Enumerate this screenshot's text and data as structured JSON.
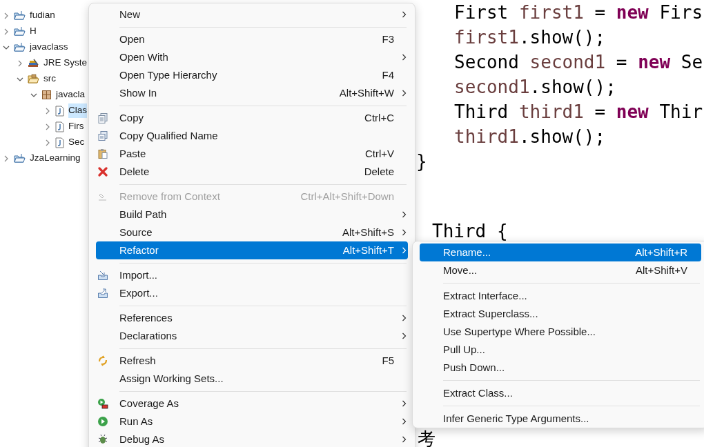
{
  "project_tree": [
    {
      "label": "fudian",
      "kind": "project",
      "expanded": false,
      "selected": false
    },
    {
      "label": "H",
      "kind": "project",
      "expanded": false,
      "selected": false
    },
    {
      "label": "javaclass",
      "kind": "project",
      "expanded": true,
      "selected": false,
      "children": [
        {
          "label": "JRE Syste",
          "kind": "library",
          "expanded": false,
          "selected": false
        },
        {
          "label": "src",
          "kind": "source-folder",
          "expanded": true,
          "selected": false,
          "children": [
            {
              "label": "javacla",
              "kind": "package",
              "expanded": true,
              "selected": false,
              "children": [
                {
                  "label": "Clas",
                  "kind": "java-file",
                  "expanded": false,
                  "selected": true
                },
                {
                  "label": "Firs",
                  "kind": "java-file",
                  "expanded": false,
                  "selected": false
                },
                {
                  "label": "Sec",
                  "kind": "java-file",
                  "expanded": false,
                  "selected": false
                }
              ]
            }
          ]
        }
      ]
    },
    {
      "label": "JzaLearning",
      "kind": "project",
      "expanded": false,
      "selected": false
    }
  ],
  "code_lines": [
    {
      "tokens": [
        {
          "text": "First ",
          "kind": "plain"
        },
        {
          "text": "first1",
          "kind": "variable"
        },
        {
          "text": " = ",
          "kind": "plain"
        },
        {
          "text": "new",
          "kind": "keyword"
        },
        {
          "text": " Firs",
          "kind": "plain"
        }
      ]
    },
    {
      "tokens": [
        {
          "text": "first1",
          "kind": "variable"
        },
        {
          "text": ".show();",
          "kind": "plain"
        }
      ]
    },
    {
      "tokens": [
        {
          "text": "Second ",
          "kind": "plain"
        },
        {
          "text": "second1",
          "kind": "variable"
        },
        {
          "text": " = ",
          "kind": "plain"
        },
        {
          "text": "new",
          "kind": "keyword"
        },
        {
          "text": " Se",
          "kind": "plain"
        }
      ]
    },
    {
      "tokens": [
        {
          "text": "second1",
          "kind": "variable"
        },
        {
          "text": ".show();",
          "kind": "plain"
        }
      ]
    },
    {
      "tokens": [
        {
          "text": "Third ",
          "kind": "plain"
        },
        {
          "text": "third1",
          "kind": "variable"
        },
        {
          "text": " = ",
          "kind": "plain"
        },
        {
          "text": "new",
          "kind": "keyword"
        },
        {
          "text": " Thir",
          "kind": "plain"
        }
      ]
    },
    {
      "tokens": [
        {
          "text": "third1",
          "kind": "variable"
        },
        {
          "text": ".show();",
          "kind": "plain"
        }
      ]
    },
    {
      "tokens": [
        {
          "text": "}",
          "kind": "plain"
        }
      ]
    },
    {
      "tokens": [
        {
          "text": "Third {",
          "kind": "plain"
        }
      ]
    },
    {
      "tokens": [
        {
          "text": "考",
          "kind": "plain"
        }
      ]
    }
  ],
  "context_menu": [
    {
      "kind": "item",
      "label": "New",
      "has_submenu": true,
      "disabled": false,
      "selected": false
    },
    {
      "kind": "separator"
    },
    {
      "kind": "item",
      "label": "Open",
      "shortcut": "F3",
      "has_submenu": false,
      "disabled": false,
      "selected": false
    },
    {
      "kind": "item",
      "label": "Open With",
      "has_submenu": true,
      "disabled": false,
      "selected": false
    },
    {
      "kind": "item",
      "label": "Open Type Hierarchy",
      "shortcut": "F4",
      "has_submenu": false,
      "disabled": false,
      "selected": false
    },
    {
      "kind": "item",
      "label": "Show In",
      "shortcut": "Alt+Shift+W",
      "has_submenu": true,
      "disabled": false,
      "selected": false
    },
    {
      "kind": "separator"
    },
    {
      "kind": "item",
      "label": "Copy",
      "shortcut": "Ctrl+C",
      "has_submenu": false,
      "disabled": false,
      "selected": false
    },
    {
      "kind": "item",
      "label": "Copy Qualified Name",
      "has_submenu": false,
      "disabled": false,
      "selected": false
    },
    {
      "kind": "item",
      "label": "Paste",
      "shortcut": "Ctrl+V",
      "has_submenu": false,
      "disabled": false,
      "selected": false
    },
    {
      "kind": "item",
      "label": "Delete",
      "shortcut": "Delete",
      "has_submenu": false,
      "disabled": false,
      "selected": false
    },
    {
      "kind": "separator"
    },
    {
      "kind": "item",
      "label": "Remove from Context",
      "shortcut": "Ctrl+Alt+Shift+Down",
      "has_submenu": false,
      "disabled": true,
      "selected": false
    },
    {
      "kind": "item",
      "label": "Build Path",
      "has_submenu": true,
      "disabled": false,
      "selected": false
    },
    {
      "kind": "item",
      "label": "Source",
      "shortcut": "Alt+Shift+S",
      "has_submenu": true,
      "disabled": false,
      "selected": false
    },
    {
      "kind": "item",
      "label": "Refactor",
      "shortcut": "Alt+Shift+T",
      "has_submenu": true,
      "disabled": false,
      "selected": true
    },
    {
      "kind": "separator"
    },
    {
      "kind": "item",
      "label": "Import...",
      "has_submenu": false,
      "disabled": false,
      "selected": false
    },
    {
      "kind": "item",
      "label": "Export...",
      "has_submenu": false,
      "disabled": false,
      "selected": false
    },
    {
      "kind": "separator"
    },
    {
      "kind": "item",
      "label": "References",
      "has_submenu": true,
      "disabled": false,
      "selected": false
    },
    {
      "kind": "item",
      "label": "Declarations",
      "has_submenu": true,
      "disabled": false,
      "selected": false
    },
    {
      "kind": "separator"
    },
    {
      "kind": "item",
      "label": "Refresh",
      "shortcut": "F5",
      "has_submenu": false,
      "disabled": false,
      "selected": false
    },
    {
      "kind": "item",
      "label": "Assign Working Sets...",
      "has_submenu": false,
      "disabled": false,
      "selected": false
    },
    {
      "kind": "separator"
    },
    {
      "kind": "item",
      "label": "Coverage As",
      "has_submenu": true,
      "disabled": false,
      "selected": false
    },
    {
      "kind": "item",
      "label": "Run As",
      "has_submenu": true,
      "disabled": false,
      "selected": false
    },
    {
      "kind": "item",
      "label": "Debug As",
      "has_submenu": true,
      "disabled": false,
      "selected": false
    }
  ],
  "refactor_submenu": [
    {
      "kind": "item",
      "label": "Rename...",
      "shortcut": "Alt+Shift+R",
      "selected": true
    },
    {
      "kind": "item",
      "label": "Move...",
      "shortcut": "Alt+Shift+V",
      "selected": false
    },
    {
      "kind": "separator"
    },
    {
      "kind": "item",
      "label": "Extract Interface...",
      "selected": false
    },
    {
      "kind": "item",
      "label": "Extract Superclass...",
      "selected": false
    },
    {
      "kind": "item",
      "label": "Use Supertype Where Possible...",
      "selected": false
    },
    {
      "kind": "item",
      "label": "Pull Up...",
      "selected": false
    },
    {
      "kind": "item",
      "label": "Push Down...",
      "selected": false
    },
    {
      "kind": "separator"
    },
    {
      "kind": "item",
      "label": "Extract Class...",
      "selected": false
    },
    {
      "kind": "separator"
    },
    {
      "kind": "item",
      "label": "Infer Generic Type Arguments...",
      "selected": false
    }
  ]
}
